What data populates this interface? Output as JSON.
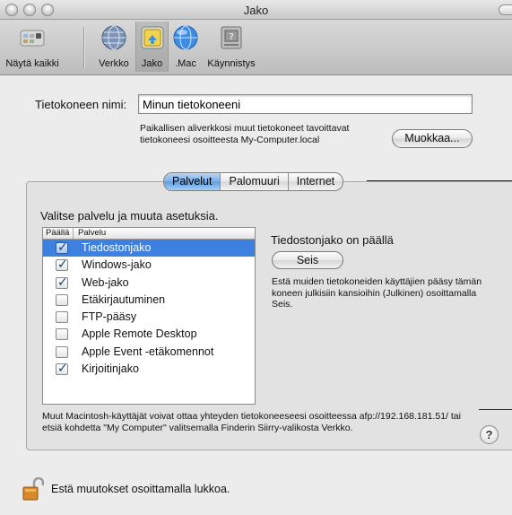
{
  "window": {
    "title": "Jako"
  },
  "toolbar": {
    "items": [
      {
        "label": "Näytä kaikki",
        "icon": "show-all-icon"
      },
      {
        "label": "Verkko",
        "icon": "network-globe-icon"
      },
      {
        "label": "Jako",
        "icon": "sharing-icon",
        "selected": true
      },
      {
        "label": ".Mac",
        "icon": "dotmac-globe-icon"
      },
      {
        "label": "Käynnistys",
        "icon": "startup-disk-icon"
      }
    ]
  },
  "computer": {
    "name_label": "Tietokoneen nimi:",
    "name_value": "Minun tietokoneeni",
    "note": "Paikallisen aliverkkosi muut tietokoneet tavoittavat tietokoneesi osoitteesta My-Computer.local",
    "edit_button": "Muokkaa..."
  },
  "tabs": [
    {
      "label": "Palvelut",
      "active": true
    },
    {
      "label": "Palomuuri",
      "active": false
    },
    {
      "label": "Internet",
      "active": false
    }
  ],
  "services": {
    "instruction": "Valitse palvelu ja muuta asetuksia.",
    "columns": {
      "on": "Päällä",
      "service": "Palvelu"
    },
    "rows": [
      {
        "name": "Tiedostonjako",
        "checked": true,
        "selected": true
      },
      {
        "name": "Windows-jako",
        "checked": true,
        "selected": false
      },
      {
        "name": "Web-jako",
        "checked": true,
        "selected": false
      },
      {
        "name": "Etäkirjautuminen",
        "checked": false,
        "selected": false
      },
      {
        "name": "FTP-pääsy",
        "checked": false,
        "selected": false
      },
      {
        "name": "Apple Remote Desktop",
        "checked": false,
        "selected": false
      },
      {
        "name": "Apple Event -etäkomennot",
        "checked": false,
        "selected": false
      },
      {
        "name": "Kirjoitinjako",
        "checked": true,
        "selected": false
      }
    ]
  },
  "status": {
    "title": "Tiedostonjako on päällä",
    "stop_button": "Seis",
    "description": "Estä muiden tietokoneiden käyttäjien pääsy tämän koneen julkisiin kansioihin (Julkinen) osoittamalla Seis."
  },
  "footer": {
    "note": "Muut Macintosh-käyttäjät voivat ottaa yhteyden tietokoneeseesi osoitteessa afp://192.168.181.51/ tai etsiä kohdetta \"My Computer\" valitsemalla Finderin Siirry-valikosta Verkko.",
    "help": "?",
    "lock_text": "Estä muutokset osoittamalla lukkoa."
  }
}
